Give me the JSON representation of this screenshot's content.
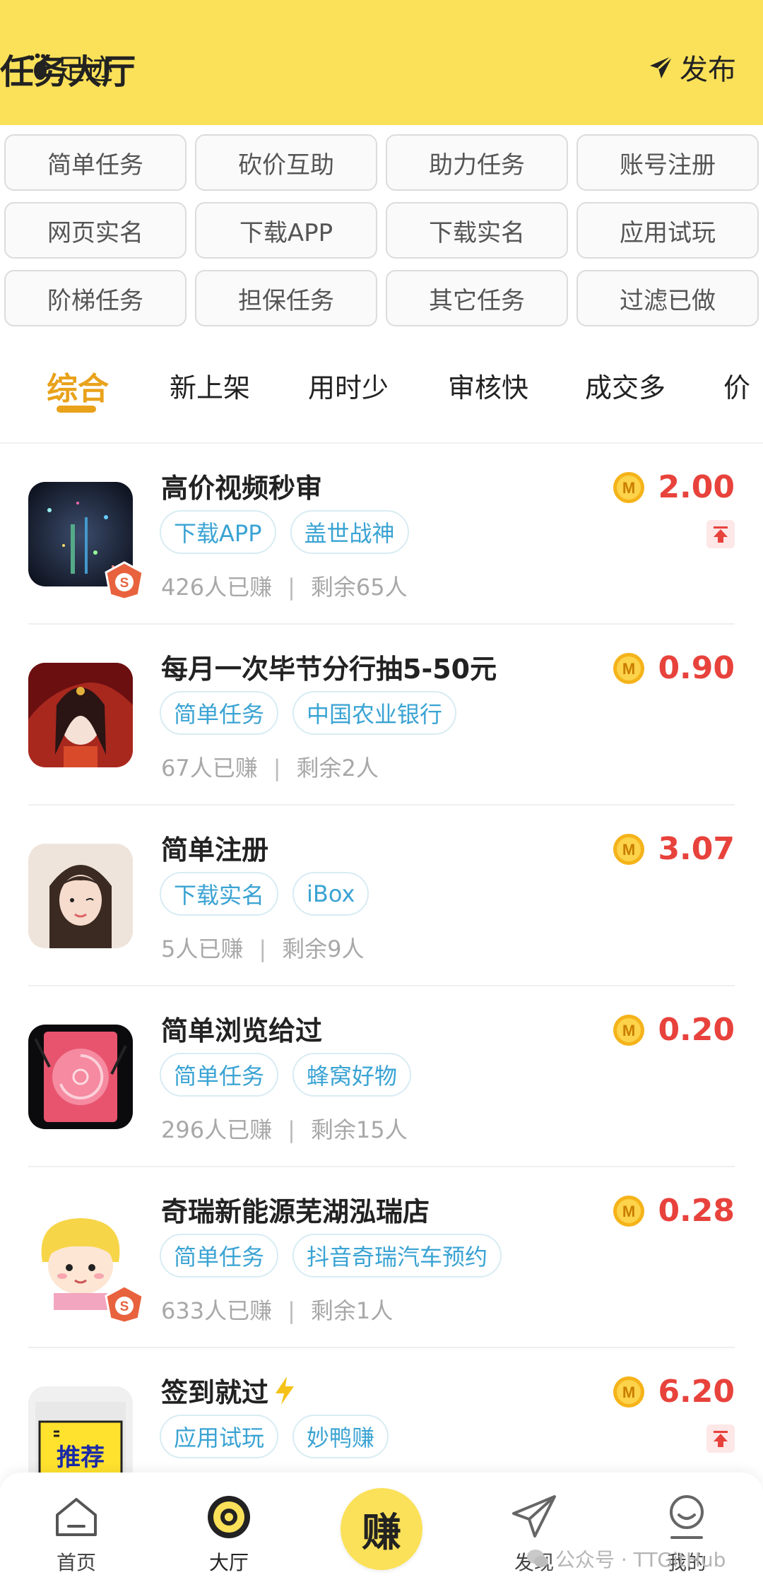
{
  "header": {
    "left_label": "足迹",
    "title": "任务大厅",
    "right_label": "发布"
  },
  "categories": [
    "简单任务",
    "砍价互助",
    "助力任务",
    "账号注册",
    "网页实名",
    "下载APP",
    "下载实名",
    "应用试玩",
    "阶梯任务",
    "担保任务",
    "其它任务",
    "过滤已做"
  ],
  "sort_tabs": [
    {
      "label": "综合",
      "active": true
    },
    {
      "label": "新上架",
      "active": false
    },
    {
      "label": "用时少",
      "active": false
    },
    {
      "label": "审核快",
      "active": false
    },
    {
      "label": "成交多",
      "active": false
    },
    {
      "label": "价",
      "active": false
    }
  ],
  "tasks": [
    {
      "title": "高价视频秒审",
      "tags": [
        "下载APP",
        "盖世战神"
      ],
      "earned": "426人已赚",
      "remaining": "剩余65人",
      "price": "2.00",
      "badge": "S",
      "pinned": true,
      "lightning": false,
      "thumb": "dark-city"
    },
    {
      "title": "每月一次毕节分行抽5-50元",
      "tags": [
        "简单任务",
        "中国农业银行"
      ],
      "earned": "67人已赚",
      "remaining": "剩余2人",
      "price": "0.90",
      "badge": "",
      "pinned": false,
      "lightning": false,
      "thumb": "red-portrait"
    },
    {
      "title": "简单注册",
      "tags": [
        "下载实名",
        "iBox"
      ],
      "earned": "5人已赚",
      "remaining": "剩余9人",
      "price": "3.07",
      "badge": "",
      "pinned": false,
      "lightning": false,
      "thumb": "girl-portrait"
    },
    {
      "title": "简单浏览给过",
      "tags": [
        "简单任务",
        "蜂窝好物"
      ],
      "earned": "296人已赚",
      "remaining": "剩余15人",
      "price": "0.20",
      "badge": "",
      "pinned": false,
      "lightning": false,
      "thumb": "pink-swirl"
    },
    {
      "title": "奇瑞新能源芜湖泓瑞店",
      "tags": [
        "简单任务",
        "抖音奇瑞汽车预约"
      ],
      "earned": "633人已赚",
      "remaining": "剩余1人",
      "price": "0.28",
      "badge": "S",
      "pinned": false,
      "lightning": false,
      "thumb": "cartoon-kid"
    },
    {
      "title": "签到就过",
      "tags": [
        "应用试玩",
        "妙鸭赚"
      ],
      "earned": "",
      "remaining": "",
      "price": "6.20",
      "badge": "",
      "pinned": true,
      "lightning": true,
      "thumb": "recommend-sign",
      "thumb_text": "推荐"
    }
  ],
  "coin_letter": "M",
  "bottom_nav": [
    {
      "label": "首页",
      "icon": "home-icon",
      "active": false
    },
    {
      "label": "大厅",
      "icon": "hall-icon",
      "active": true
    },
    {
      "label": "赚",
      "icon": "earn-button",
      "active": false
    },
    {
      "label": "发现",
      "icon": "discover-icon",
      "active": false
    },
    {
      "label": "我的",
      "icon": "profile-icon",
      "active": false
    }
  ],
  "watermark": "公众号 · TTGitHub",
  "colors": {
    "header_bg": "#fbe159",
    "active_tab": "#e9a21b",
    "price": "#e8423c",
    "tag_text": "#3aa3d3"
  }
}
